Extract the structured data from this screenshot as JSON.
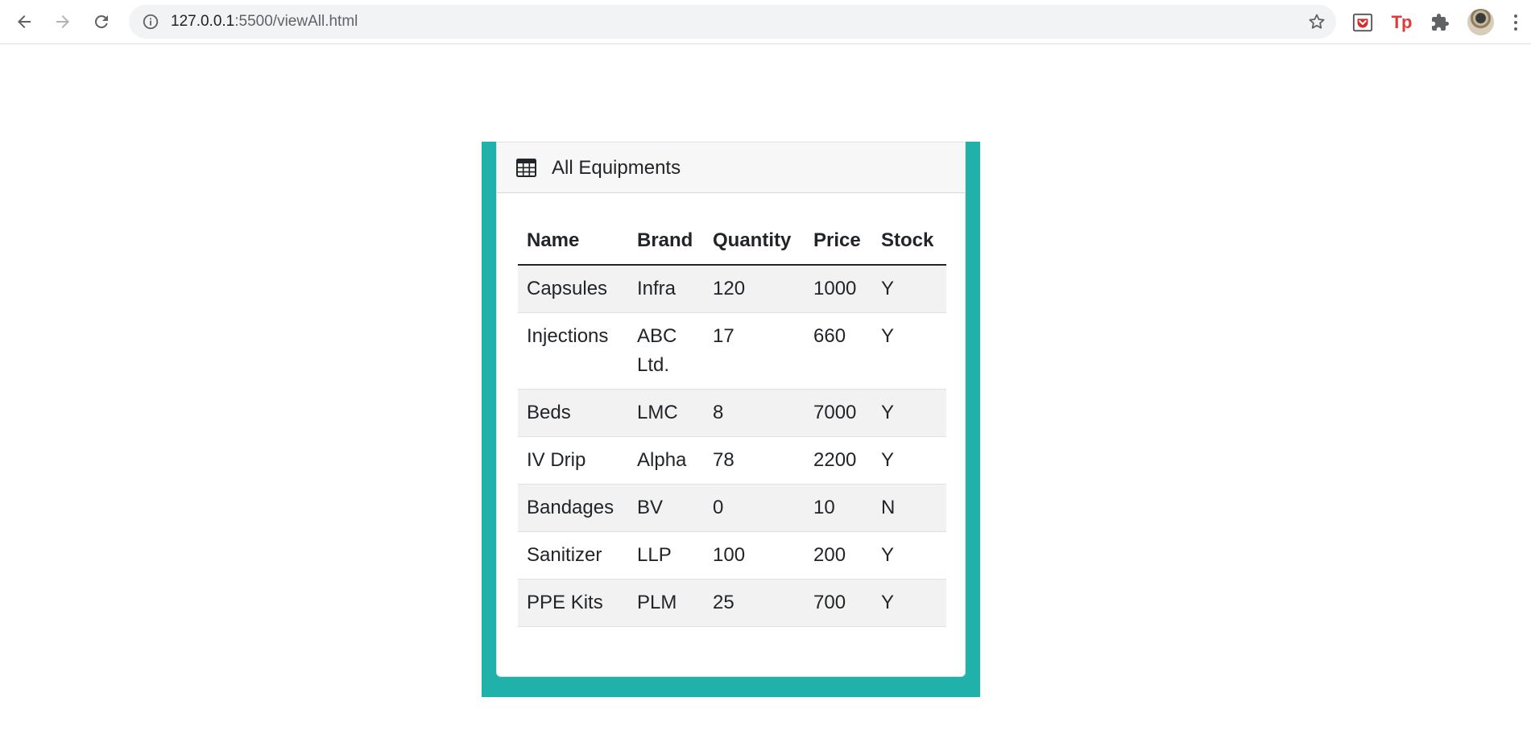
{
  "browser": {
    "url_host": "127.0.0.1",
    "url_rest": ":5500/viewAll.html",
    "extensions": [
      "pocket-icon",
      "tp-icon",
      "puzzle-icon"
    ]
  },
  "card": {
    "title": "All Equipments",
    "icon": "table-icon"
  },
  "table": {
    "headers": [
      "Name",
      "Brand",
      "Quantity",
      "Price",
      "Stock"
    ],
    "rows": [
      [
        "Capsules",
        "Infra",
        "120",
        "1000",
        "Y"
      ],
      [
        "Injections",
        "ABC Ltd.",
        "17",
        "660",
        "Y"
      ],
      [
        "Beds",
        "LMC",
        "8",
        "7000",
        "Y"
      ],
      [
        "IV Drip",
        "Alpha",
        "78",
        "2200",
        "Y"
      ],
      [
        "Bandages",
        "BV",
        "0",
        "10",
        "N"
      ],
      [
        "Sanitizer",
        "LLP",
        "100",
        "200",
        "Y"
      ],
      [
        "PPE Kits",
        "PLM",
        "25",
        "700",
        "Y"
      ]
    ]
  },
  "colors": {
    "frame": "#20b2aa",
    "stripe": "#f2f2f2",
    "tp_red": "#e53935",
    "pocket_red": "#d32f2f"
  }
}
